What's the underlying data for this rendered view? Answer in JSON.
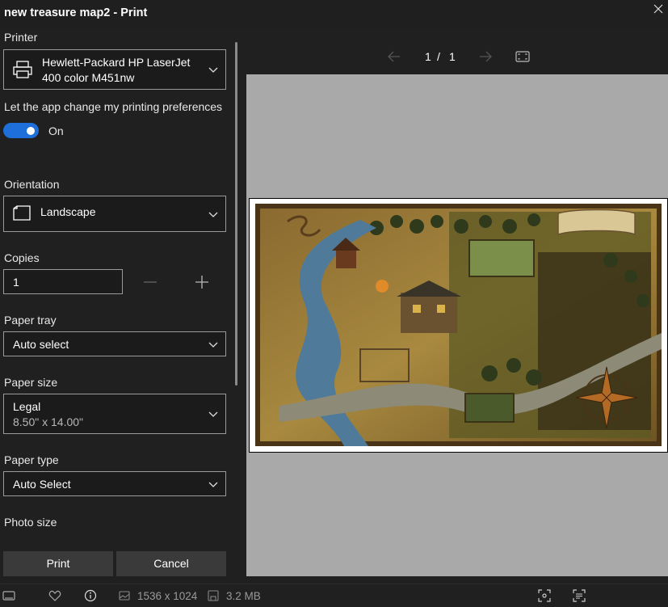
{
  "window": {
    "title": "new treasure map2 - Print"
  },
  "printer": {
    "label": "Printer",
    "name_line1": "Hewlett-Packard HP LaserJet",
    "name_line2": "400 color M451nw"
  },
  "preferences": {
    "label": "Let the app change my printing preferences",
    "toggle_state": "On"
  },
  "orientation": {
    "label": "Orientation",
    "value": "Landscape"
  },
  "copies": {
    "label": "Copies",
    "value": "1"
  },
  "paper_tray": {
    "label": "Paper tray",
    "value": "Auto select"
  },
  "paper_size": {
    "label": "Paper size",
    "value": "Legal",
    "dimensions": "8.50\" x 14.00\""
  },
  "paper_type": {
    "label": "Paper type",
    "value": "Auto Select"
  },
  "photo_size": {
    "label": "Photo size"
  },
  "actions": {
    "print": "Print",
    "cancel": "Cancel"
  },
  "preview": {
    "current_page": "1",
    "separator": "/",
    "total_pages": "1"
  },
  "status": {
    "dimensions": "1536 x 1024",
    "file_size": "3.2 MB"
  },
  "colors": {
    "accent": "#1e6fd9",
    "panel": "#202020",
    "preview_bg": "#a9a9a9"
  }
}
